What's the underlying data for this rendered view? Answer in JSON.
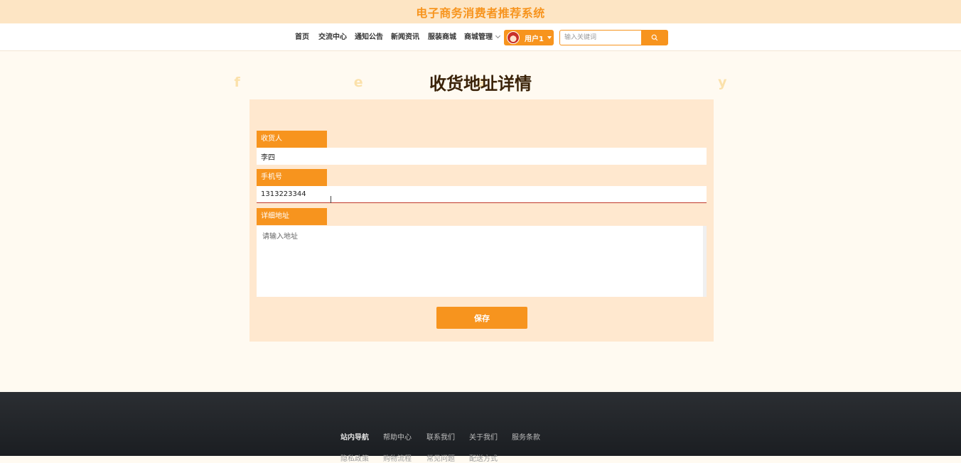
{
  "site": {
    "title": "电子商务消费者推荐系统"
  },
  "nav": {
    "items": [
      "首页",
      "交流中心",
      "通知公告",
      "新闻资讯",
      "服装商城",
      "商城管理"
    ],
    "user_label": "用户1",
    "search_placeholder": "输入关键词"
  },
  "page": {
    "heading": "收货地址详情",
    "heading_bg": "fea  y"
  },
  "form": {
    "receiver_label": "收货人",
    "receiver_value": "李四",
    "phone_label": "手机号",
    "phone_value": "1313223344",
    "address_label": "详细地址",
    "address_placeholder": "请输入地址",
    "save_label": "保存"
  },
  "footer": {
    "row1": [
      "站内导航",
      "帮助中心",
      "联系我们",
      "关于我们",
      "服务条款"
    ],
    "row2": [
      "隐私政策",
      "购物流程",
      "常见问题",
      "配送方式"
    ]
  },
  "colors": {
    "accent": "#f7941e",
    "title_bar": "#fde5c4",
    "card": "#ffe8cf",
    "footer": "#24272b"
  }
}
